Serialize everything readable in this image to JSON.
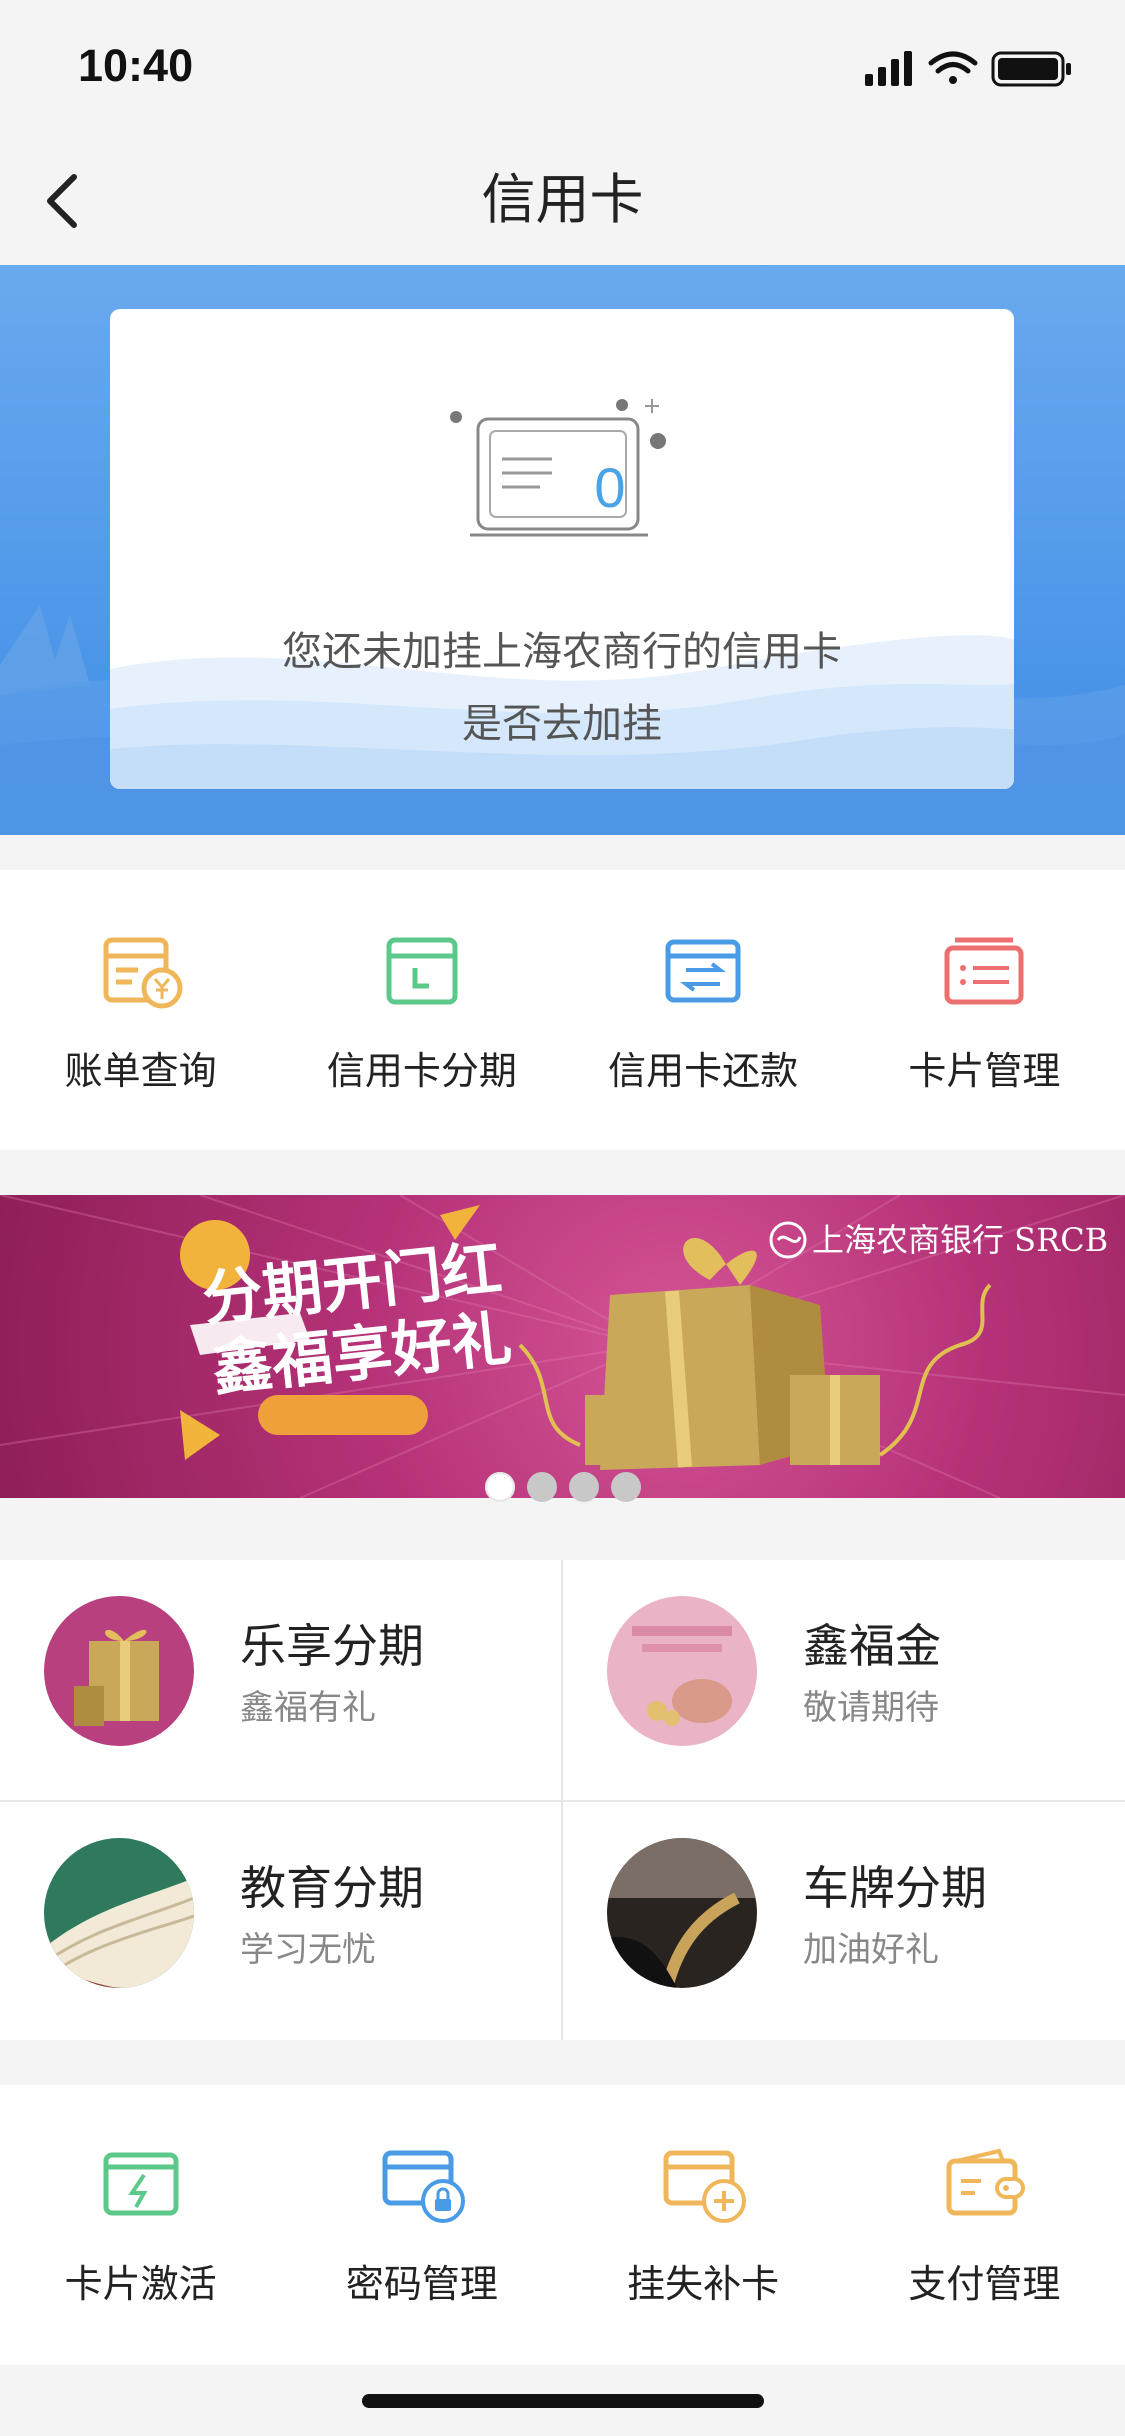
{
  "status": {
    "time": "10:40"
  },
  "nav": {
    "title": "信用卡"
  },
  "empty_card": {
    "icon_value": "0",
    "message_line1": "您还未加挂上海农商行的信用卡",
    "message_line2": "是否去加挂"
  },
  "quick_actions": [
    {
      "label": "账单查询",
      "icon": "bill-icon",
      "color": "#f0b75a"
    },
    {
      "label": "信用卡分期",
      "icon": "calendar-icon",
      "color": "#5cc98a"
    },
    {
      "label": "信用卡还款",
      "icon": "repay-icon",
      "color": "#4a9be6"
    },
    {
      "label": "卡片管理",
      "icon": "card-manage-icon",
      "color": "#ee6f6f"
    }
  ],
  "banner": {
    "brand": "上海农商银行 SRCB",
    "headline1": "分期开门红",
    "headline2": "鑫福享好礼",
    "pages": 4,
    "active_page": 1
  },
  "products": [
    {
      "name": "乐享分期",
      "sub": "鑫福有礼"
    },
    {
      "name": "鑫福金",
      "sub": "敬请期待"
    },
    {
      "name": "教育分期",
      "sub": "学习无忧"
    },
    {
      "name": "车牌分期",
      "sub": "加油好礼"
    }
  ],
  "services": [
    {
      "label": "卡片激活",
      "icon": "activate-icon",
      "color": "#5cc98a"
    },
    {
      "label": "密码管理",
      "icon": "password-icon",
      "color": "#4a9be6"
    },
    {
      "label": "挂失补卡",
      "icon": "replace-card-icon",
      "color": "#f0b75a"
    },
    {
      "label": "支付管理",
      "icon": "payment-icon",
      "color": "#f0b75a"
    }
  ]
}
